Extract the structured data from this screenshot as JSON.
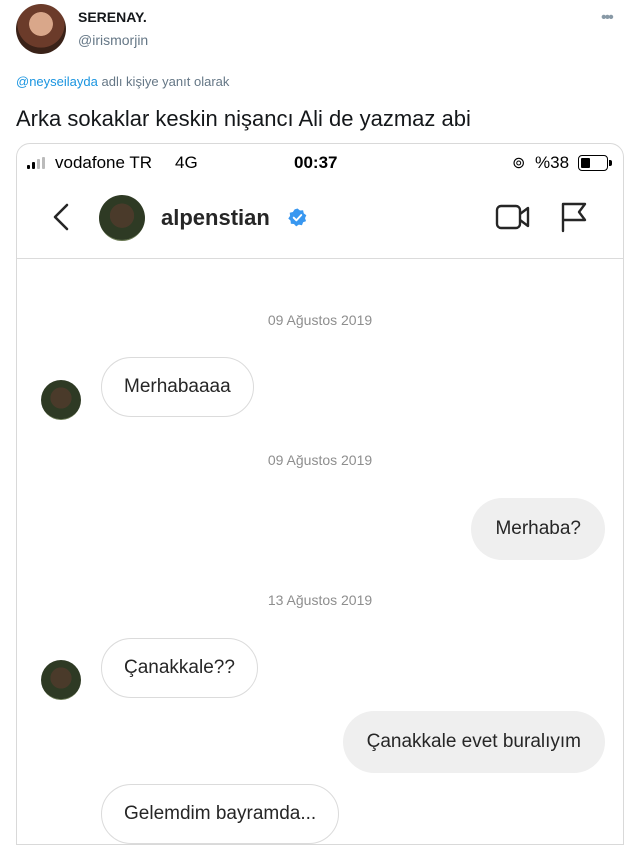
{
  "tweet": {
    "display_name": "SERENAY.",
    "handle": "@irismorjin",
    "more_icon": "more-dots-icon",
    "reply_to_mention": "@neyseilayda",
    "reply_to_suffix": "adlı kişiye yanıt olarak",
    "text": "Arka sokaklar keskin nişancı Ali de yazmaz abi"
  },
  "screenshot": {
    "status_bar": {
      "carrier": "vodafone TR",
      "network": "4G",
      "time": "00:37",
      "rotation_icon": "rotation-lock-icon",
      "battery": "%38"
    },
    "chat": {
      "username": "alpenstian",
      "verified_icon": "verified-badge-icon",
      "back_icon": "back-chevron-icon",
      "video_icon": "video-call-icon",
      "flag_icon": "flag-icon"
    },
    "messages": [
      {
        "type": "date",
        "text": "09 Ağustos 2019"
      },
      {
        "type": "incoming",
        "text": "Merhabaaaa"
      },
      {
        "type": "date",
        "text": "09 Ağustos 2019"
      },
      {
        "type": "outgoing",
        "text": "Merhaba?"
      },
      {
        "type": "date",
        "text": "13 Ağustos 2019"
      },
      {
        "type": "incoming",
        "text": "Çanakkale??"
      },
      {
        "type": "outgoing",
        "text": "Çanakkale evet buralıyım"
      },
      {
        "type": "incoming",
        "text": "Gelemdim bayramda..."
      }
    ]
  },
  "colors": {
    "mention": "#1b95e0",
    "verified": "#3897f0",
    "bubble_out": "#efefef",
    "bubble_border": "#dbdbdb"
  }
}
